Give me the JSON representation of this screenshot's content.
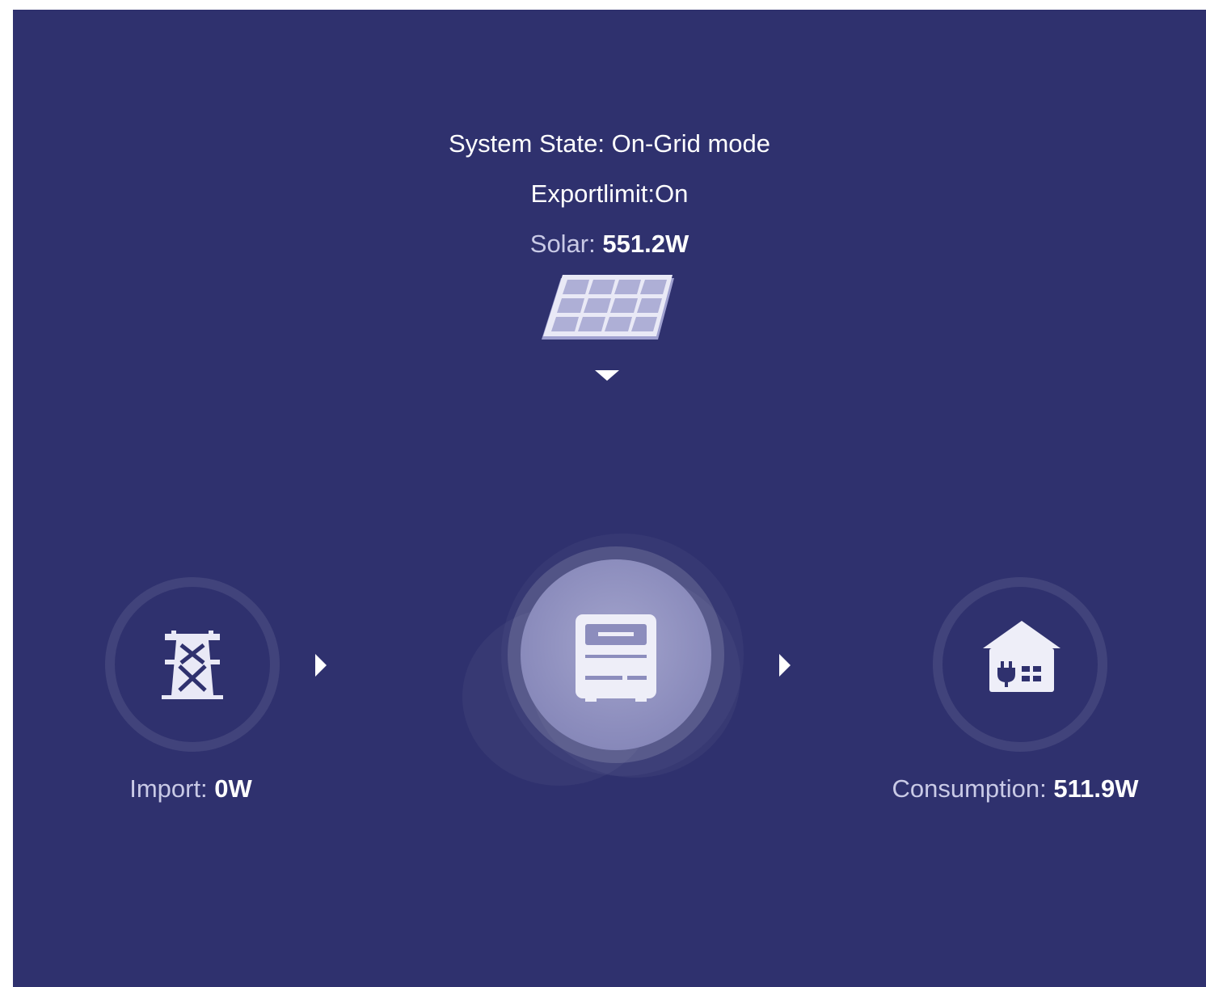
{
  "status": {
    "system_state_label": "System State:",
    "system_state_value": "On-Grid mode",
    "export_limit": "Exportlimit:On"
  },
  "solar": {
    "label": "Solar:",
    "value": "551.2W",
    "icon": "solar-panel-icon"
  },
  "grid": {
    "label": "Import:",
    "value": "0W",
    "icon": "power-tower-icon"
  },
  "inverter": {
    "icon": "inverter-icon"
  },
  "home": {
    "label": "Consumption:",
    "value": "511.9W",
    "icon": "home-plug-icon"
  },
  "colors": {
    "background": "#2f316e",
    "label": "#c9cae6",
    "value": "#ffffff"
  }
}
